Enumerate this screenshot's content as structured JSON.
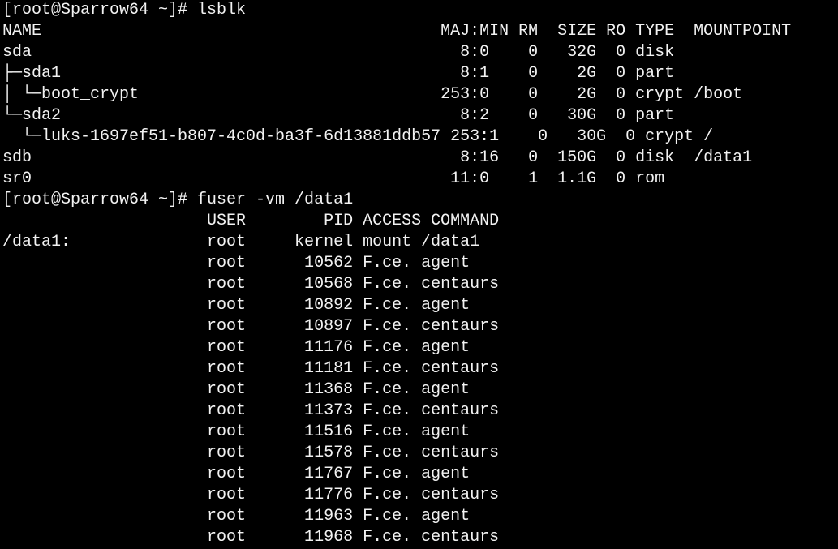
{
  "terminal": {
    "lines": [
      "[root@Sparrow64 ~]# lsblk",
      "NAME                                         MAJ:MIN RM  SIZE RO TYPE  MOUNTPOINT",
      "sda                                            8:0    0   32G  0 disk",
      "├─sda1                                         8:1    0    2G  0 part",
      "│ └─boot_crypt                               253:0    0    2G  0 crypt /boot",
      "└─sda2                                         8:2    0   30G  0 part",
      "  └─luks-1697ef51-b807-4c0d-ba3f-6d13881ddb57 253:1    0   30G  0 crypt /",
      "sdb                                            8:16   0  150G  0 disk  /data1",
      "sr0                                           11:0    1  1.1G  0 rom",
      "[root@Sparrow64 ~]# fuser -vm /data1",
      "                     USER        PID ACCESS COMMAND",
      "/data1:              root     kernel mount /data1",
      "                     root      10562 F.ce. agent",
      "                     root      10568 F.ce. centaurs",
      "                     root      10892 F.ce. agent",
      "                     root      10897 F.ce. centaurs",
      "                     root      11176 F.ce. agent",
      "                     root      11181 F.ce. centaurs",
      "                     root      11368 F.ce. agent",
      "                     root      11373 F.ce. centaurs",
      "                     root      11516 F.ce. agent",
      "                     root      11578 F.ce. centaurs",
      "                     root      11767 F.ce. agent",
      "                     root      11776 F.ce. centaurs",
      "                     root      11963 F.ce. agent",
      "                     root      11968 F.ce. centaurs"
    ]
  }
}
